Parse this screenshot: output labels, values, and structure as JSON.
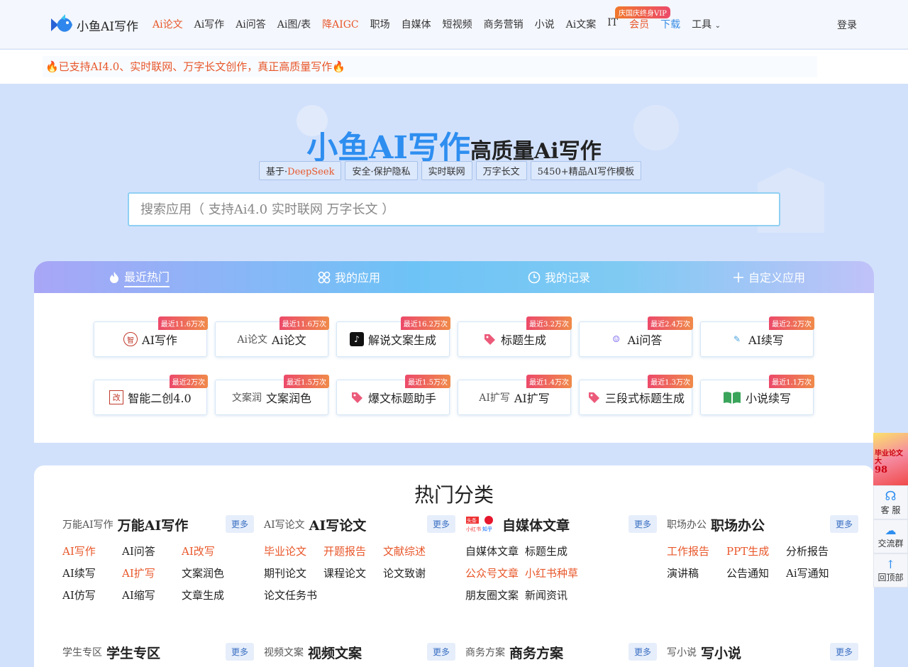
{
  "header": {
    "logo_text": "小鱼AI写作",
    "nav": [
      "Ai论文",
      "Ai写作",
      "Ai问答",
      "Ai图/表",
      "降AIGC",
      "职场",
      "自媒体",
      "短视频",
      "商务营销",
      "小说",
      "Ai文案",
      "IT",
      "会员",
      "下载",
      "工具"
    ],
    "vip_badge": "庆国庆终身VIP",
    "login": "登录"
  },
  "notice": "🔥已支持AI4.0、实时联网、万字长文创作，真正高质量写作🔥",
  "hero": {
    "title_brand": "小鱼AI写作",
    "title_rest": "高质量Ai写作",
    "tag1_prefix": "基于·",
    "tag1_red": "DeepSeek",
    "tags": [
      "安全·保护隐私",
      "实时联网",
      "万字长文",
      "5450+精品AI写作模板"
    ],
    "search_placeholder": "搜索应用（ 支持Ai4.0 实时联网 万字长文 ）"
  },
  "tabs": [
    "最近热门",
    "我的应用",
    "我的记录",
    "自定义应用"
  ],
  "apps": [
    {
      "label": "AI写作",
      "badge": "最近11.6万次"
    },
    {
      "label": "Ai论文",
      "badge": "最近11.6万次",
      "alt": "Ai论文"
    },
    {
      "label": "解说文案生成",
      "badge": "最近16.2万次"
    },
    {
      "label": "标题生成",
      "badge": "最近3.2万次"
    },
    {
      "label": "Ai问答",
      "badge": "最近2.4万次"
    },
    {
      "label": "AI续写",
      "badge": "最近2.2万次"
    },
    {
      "label": "智能二创4.0",
      "badge": "最近2万次"
    },
    {
      "label": "文案润色",
      "badge": "最近1.5万次",
      "alt": "文案润"
    },
    {
      "label": "爆文标题助手",
      "badge": "最近1.5万次"
    },
    {
      "label": "AI扩写",
      "badge": "最近1.4万次",
      "alt": "AI扩写"
    },
    {
      "label": "三段式标题生成",
      "badge": "最近1.3万次"
    },
    {
      "label": "小说续写",
      "badge": "最近1.1万次"
    }
  ],
  "categories": {
    "title": "热门分类",
    "more": "更多",
    "cols": [
      {
        "alt": "万能AI写作",
        "name": "万能AI写作",
        "links": [
          "AI写作",
          "AI问答",
          "AI改写",
          "AI续写",
          "AI扩写",
          "文案润色",
          "AI仿写",
          "AI缩写",
          "文章生成"
        ]
      },
      {
        "alt": "AI写论文",
        "name": "AI写论文",
        "links": [
          "毕业论文",
          "开题报告",
          "文献综述",
          "期刊论文",
          "课程论文",
          "论文致谢",
          "论文任务书"
        ]
      },
      {
        "alt": "",
        "name": "自媒体文章",
        "links": [
          "自媒体文章",
          "标题生成",
          "",
          "公众号文章",
          "小红书种草",
          "",
          "朋友圈文案",
          "新闻资讯"
        ]
      },
      {
        "alt": "职场办公",
        "name": "职场办公",
        "links": [
          "工作报告",
          "PPT生成",
          "分析报告",
          "演讲稿",
          "公告通知",
          "Ai写通知"
        ]
      },
      {
        "alt": "学生专区",
        "name": "学生专区",
        "links": []
      },
      {
        "alt": "视频文案",
        "name": "视频文案",
        "links": []
      },
      {
        "alt": "商务方案",
        "name": "商务方案",
        "links": []
      },
      {
        "alt": "写小说",
        "name": "写小说",
        "links": []
      }
    ]
  },
  "side": {
    "promo": "毕业论文大",
    "promo_num": "98",
    "service": "客 服",
    "group": "交流群",
    "top": "回顶部"
  },
  "colors": {
    "accent": "#e8572a",
    "brand_blue": "#2e8ef0",
    "hero_bg": "#d2e1fb"
  }
}
